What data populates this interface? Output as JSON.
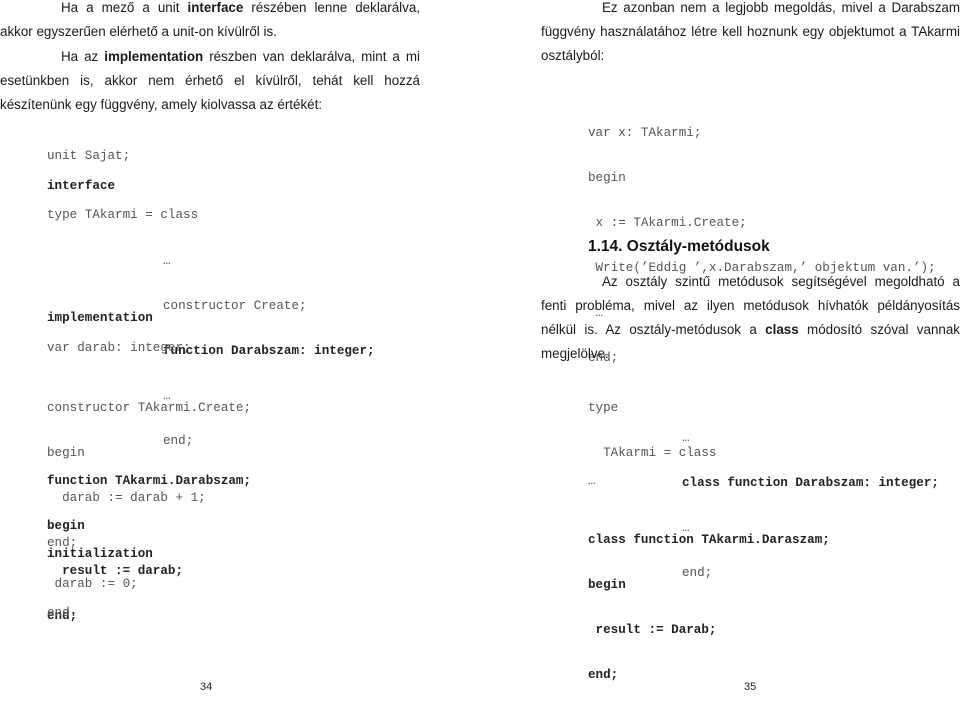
{
  "left_page": {
    "paragraph1": {
      "pre": "Ha a mező a unit ",
      "bold": "interface",
      "post": " részében lenne deklarálva, akkor egyszerűen elérhető a unit-on kívülről is."
    },
    "paragraph2": {
      "pre": "Ha az ",
      "bold": "implementation",
      "post": " részben van deklarálva, mint a mi esetünkben is, akkor nem érhető el kívülről, tehát kell hozzá készítenünk egy függvény, amely kiolvassa az értékét:"
    },
    "code": {
      "unit_line": "unit Sajat;",
      "interface_kw": "interface",
      "type_line": "type TAkarmi = class",
      "ellipsis1": "…",
      "constructor_decl": "constructor Create;",
      "function_decl": "function Darabszam: integer;",
      "ellipsis2": "…",
      "end_class": "end;",
      "implementation_kw": "implementation",
      "var_line": "var darab: integer;",
      "ctor_impl": "constructor TAkarmi.Create;",
      "ctor_begin": "begin",
      "ctor_body": "  darab := darab + 1;",
      "ctor_end": "end;",
      "func_impl": "function TAkarmi.Darabszam;",
      "func_begin": "begin",
      "func_body": "  result := darab;",
      "func_end": "end;",
      "ellipsis3": "…",
      "initialization_kw": "initialization",
      "init_body": " darab := 0;",
      "unit_end": "end."
    },
    "page_number": "34"
  },
  "right_page": {
    "paragraph1": "Ez azonban nem a legjobb megoldás, mivel a Darabszam függvény használatához létre kell hoznunk egy objektumot a TAkarmi osztályból:",
    "code1": {
      "var_line": "var x: TAkarmi;",
      "begin": "begin",
      "create_line": " x := TAkarmi.Create;",
      "write_line": " Write(’Eddig ’,x.Darabszam,’ objektum van.’);",
      "ellipsis": " …",
      "end": "end;"
    },
    "heading": "1.14. Osztály-metódusok",
    "paragraph2": {
      "pre": "Az osztály szintű metódusok segítségével megoldható a fenti probléma, mivel az ilyen metódusok hívhatók példányosítás nélkül is. Az osztály-metódusok a ",
      "bold": "class",
      "post": " módosító szóval vannak megjelölve."
    },
    "code2": {
      "type_kw": "type",
      "class_line": "  TAkarmi = class",
      "ellipsis1": "…",
      "class_func_decl": "class function Darabszam: integer;",
      "ellipsis2": "…",
      "end_class": "end;",
      "ellipsis3": "…",
      "class_func_impl": "class function TAkarmi.Daraszam;",
      "begin": "begin",
      "body": " result := Darab;",
      "end": "end;",
      "ellipsis4": "…"
    },
    "page_number": "35"
  }
}
